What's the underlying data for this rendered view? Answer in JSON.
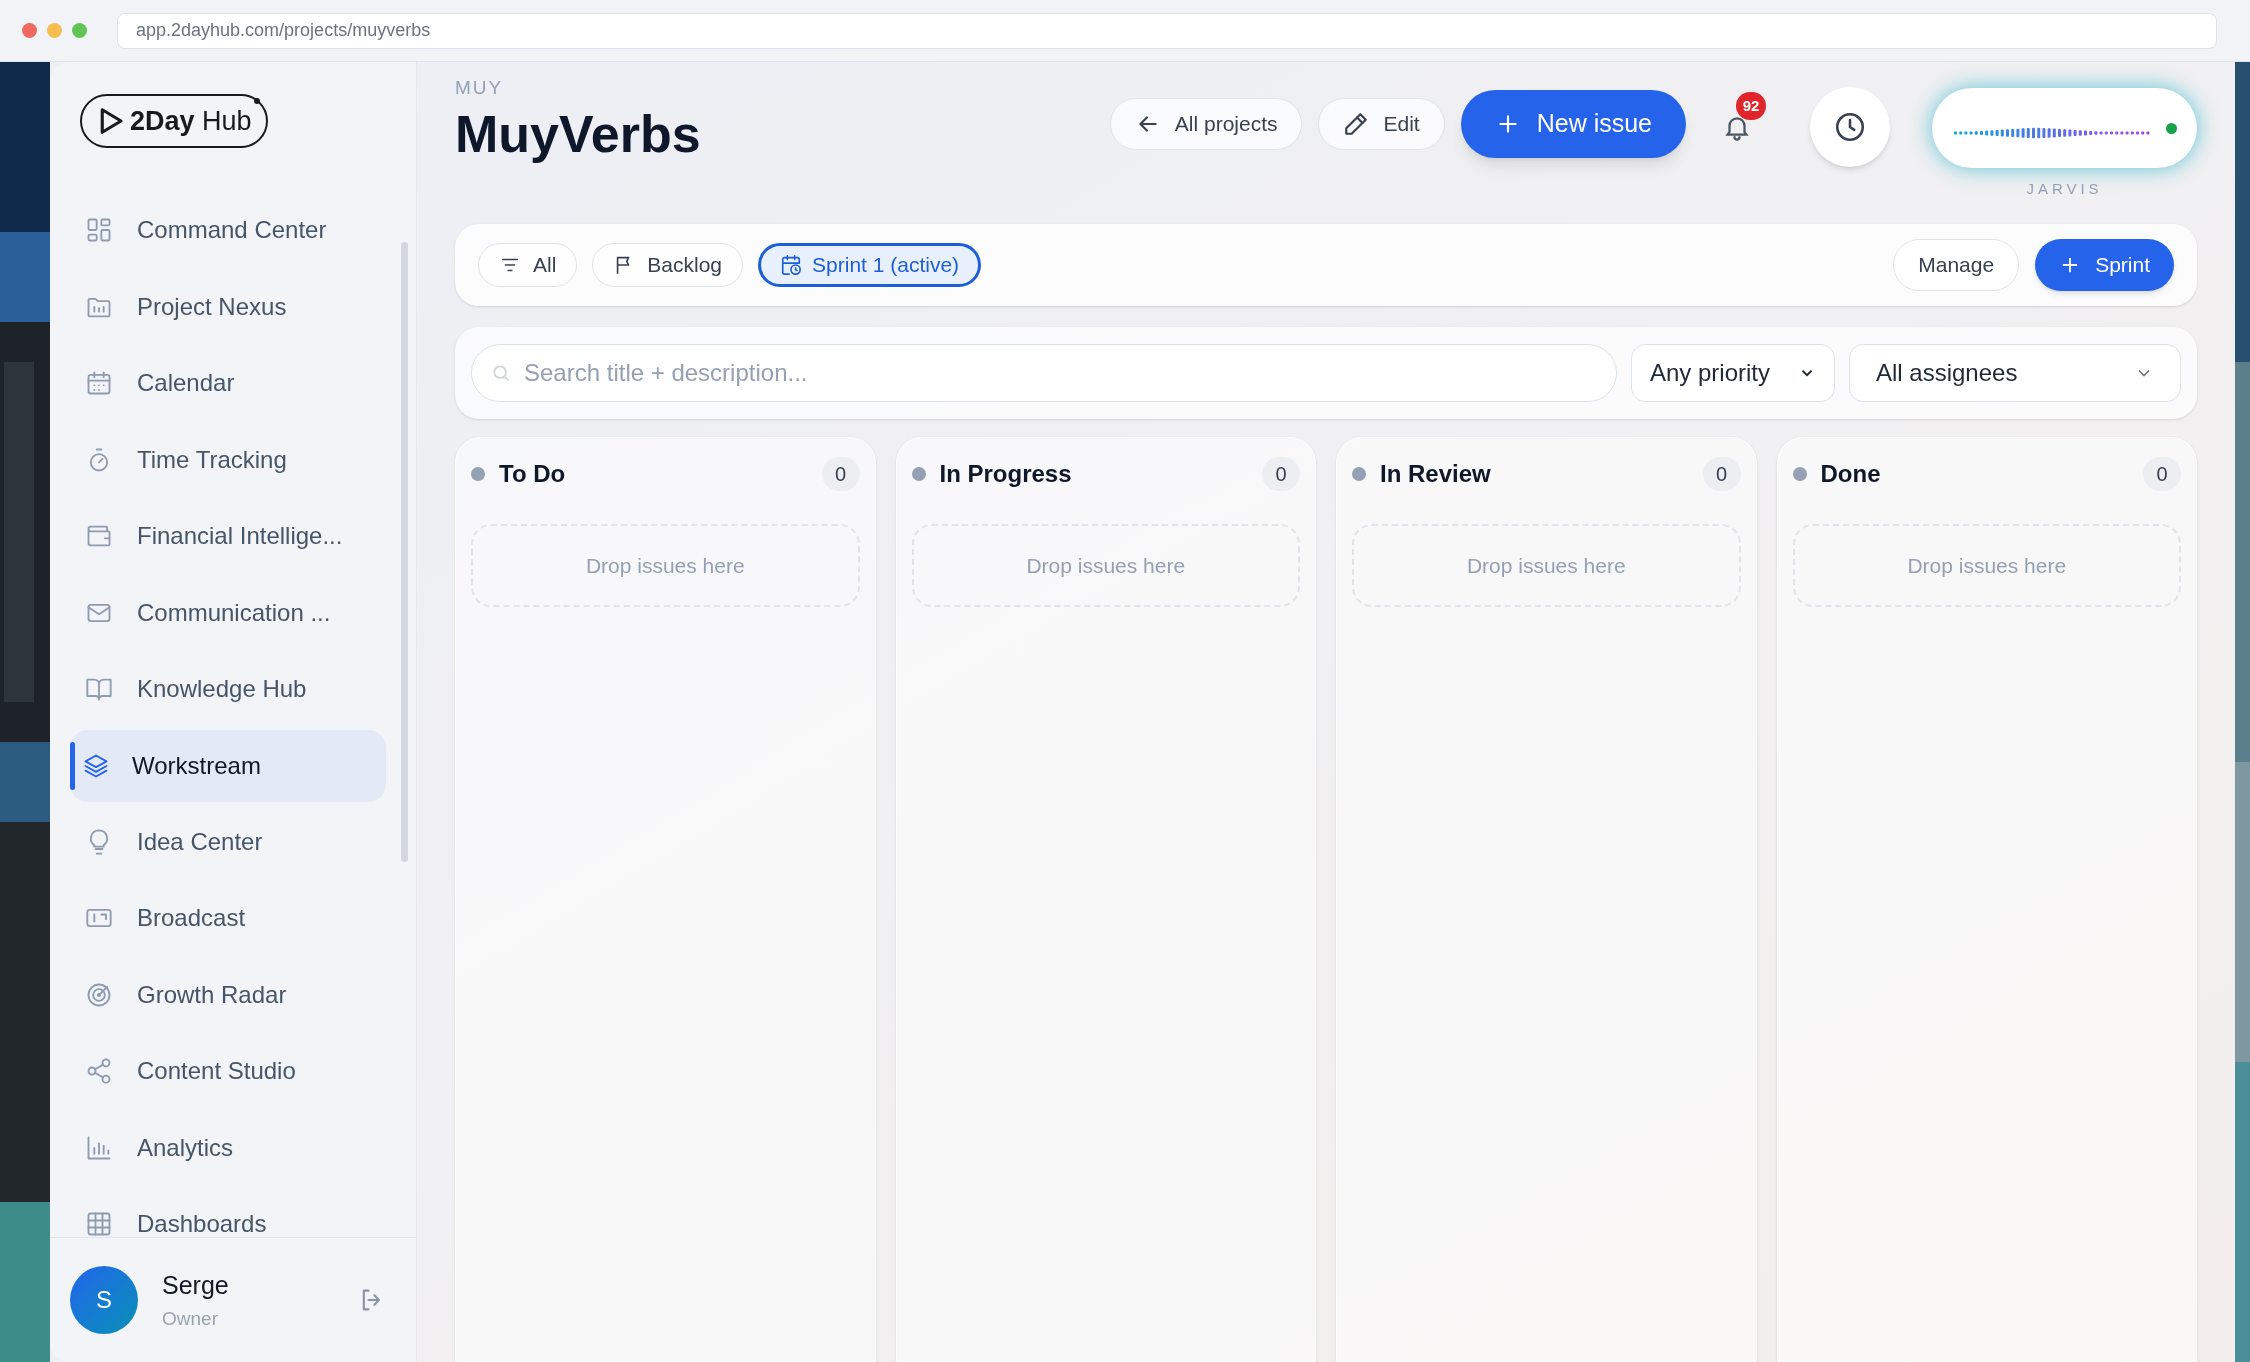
{
  "browser": {
    "url": "app.2dayhub.com/projects/muyverbs"
  },
  "sidebar": {
    "logo": {
      "brand_bold": "2Day",
      "brand_light": "Hub"
    },
    "items": [
      {
        "label": "Command Center",
        "kind": "grid",
        "selected": false
      },
      {
        "label": "Project Nexus",
        "kind": "folder",
        "selected": false
      },
      {
        "label": "Calendar",
        "kind": "calendar",
        "selected": false
      },
      {
        "label": "Time Tracking",
        "kind": "timer",
        "selected": false
      },
      {
        "label": "Financial Intellige...",
        "kind": "wallet",
        "selected": false
      },
      {
        "label": "Communication ...",
        "kind": "mail",
        "selected": false
      },
      {
        "label": "Knowledge Hub",
        "kind": "book",
        "selected": false
      },
      {
        "label": "Workstream",
        "kind": "layers",
        "selected": true
      },
      {
        "label": "Idea Center",
        "kind": "bulb",
        "selected": false
      },
      {
        "label": "Broadcast",
        "kind": "radio",
        "selected": false
      },
      {
        "label": "Growth Radar",
        "kind": "radar",
        "selected": false
      },
      {
        "label": "Content Studio",
        "kind": "share",
        "selected": false
      },
      {
        "label": "Analytics",
        "kind": "chart",
        "selected": false
      },
      {
        "label": "Dashboards",
        "kind": "table",
        "selected": false
      }
    ],
    "user": {
      "initial": "S",
      "name": "Serge",
      "role": "Owner"
    }
  },
  "header": {
    "project_key": "MUY",
    "title": "MuyVerbs",
    "buttons": [
      {
        "label": "All projects",
        "kind": "back"
      },
      {
        "label": "Edit",
        "kind": "edit"
      },
      {
        "label": "New issue",
        "kind": "primary"
      }
    ],
    "notifications": {
      "count": "92"
    },
    "assistant": {
      "label": "JARVIS",
      "online": true
    }
  },
  "filters": {
    "chips": [
      {
        "label": "All",
        "kind": "filter",
        "selected": false
      },
      {
        "label": "Backlog",
        "kind": "flag",
        "selected": false
      },
      {
        "label": "Sprint 1 (active)",
        "kind": "calendar-clock",
        "selected": true
      }
    ],
    "actions": [
      {
        "label": "Manage",
        "kind": "secondary"
      },
      {
        "label": "Sprint",
        "kind": "primary"
      }
    ]
  },
  "search": {
    "placeholder": "Search title + description...",
    "priority": "Any priority",
    "assignee": "All assignees"
  },
  "board": {
    "columns": [
      {
        "title": "To Do",
        "count": "0",
        "empty_text": "Drop issues here"
      },
      {
        "title": "In Progress",
        "count": "0",
        "empty_text": "Drop issues here"
      },
      {
        "title": "In Review",
        "count": "0",
        "empty_text": "Drop issues here"
      },
      {
        "title": "Done",
        "count": "0",
        "empty_text": "Drop issues here"
      }
    ]
  }
}
